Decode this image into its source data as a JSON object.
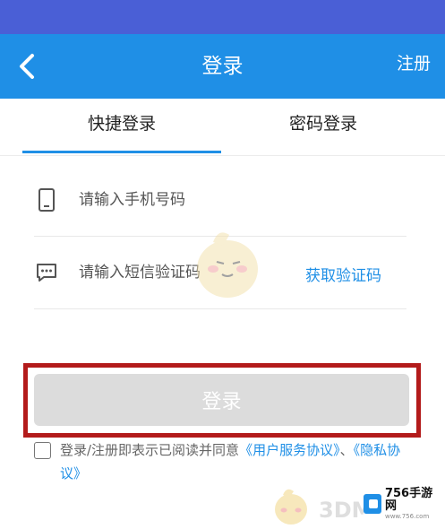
{
  "header": {
    "title": "登录",
    "register_label": "注册",
    "back_icon": "chevron-left-icon"
  },
  "tabs": [
    {
      "label": "快捷登录",
      "active": true
    },
    {
      "label": "密码登录",
      "active": false
    }
  ],
  "phone_field": {
    "placeholder": "请输入手机号码",
    "icon": "phone-icon"
  },
  "sms_field": {
    "placeholder": "请输入短信验证码",
    "icon": "message-icon",
    "get_code_label": "获取验证码"
  },
  "login_button": {
    "label": "登录"
  },
  "agreement": {
    "prefix": "登录/注册即表示已阅读并同意",
    "user_agreement": "《用户服务协议》",
    "separator": "、",
    "privacy_policy": "《隐私协议》"
  },
  "watermark": {
    "text": "3DM",
    "site_name": "756手游网",
    "site_sub": "www.756.com"
  },
  "colors": {
    "status_bar": "#4a5fd6",
    "nav_bar": "#1f8fe6",
    "accent": "#1f8fe6",
    "highlight_border": "#b31b1b",
    "login_button_disabled": "#dcdcdc"
  }
}
